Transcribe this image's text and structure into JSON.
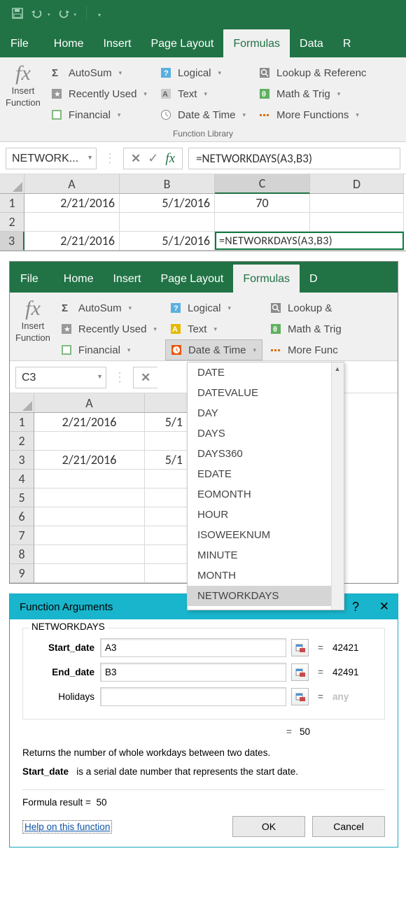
{
  "tabs": {
    "file": "File",
    "home": "Home",
    "insert": "Insert",
    "layout": "Page Layout",
    "formulas": "Formulas",
    "data": "Data",
    "r": "R"
  },
  "ribbon": {
    "insert_fn": {
      "l1": "Insert",
      "l2": "Function"
    },
    "autosum": "AutoSum",
    "recent": "Recently Used",
    "financial": "Financial",
    "logical": "Logical",
    "text": "Text",
    "datetime": "Date & Time",
    "lookup": "Lookup & Referenc",
    "lookup2": "Lookup & ",
    "math": "Math & Trig",
    "math2": "Math & Trig",
    "more": "More Functions",
    "more2": "More Func",
    "library": "Function Library"
  },
  "p1": {
    "namebox": "NETWORK...",
    "fbar": "=NETWORKDAYS(A3,B3)",
    "cols": [
      "A",
      "B",
      "C",
      "D"
    ],
    "row1": {
      "a": "2/21/2016",
      "b": "5/1/2016",
      "c": "70"
    },
    "row3": {
      "a": "2/21/2016",
      "b": "5/1/2016",
      "c": "=NETWORKDAYS(A3,B3)"
    }
  },
  "p2": {
    "namebox": "C3",
    "cols": [
      "A"
    ],
    "row1": {
      "a": "2/21/2016",
      "b": "5/1"
    },
    "row3": {
      "a": "2/21/2016",
      "b": "5/1"
    },
    "dropdown": [
      "DATE",
      "DATEVALUE",
      "DAY",
      "DAYS",
      "DAYS360",
      "EDATE",
      "EOMONTH",
      "HOUR",
      "ISOWEEKNUM",
      "MINUTE",
      "MONTH",
      "NETWORKDAYS"
    ]
  },
  "dialog": {
    "title": "Function Arguments",
    "fn": "NETWORKDAYS",
    "args": [
      {
        "label": "Start_date",
        "value": "A3",
        "result": "42421",
        "bold": true
      },
      {
        "label": "End_date",
        "value": "B3",
        "result": "42491",
        "bold": true
      },
      {
        "label": "Holidays",
        "value": "",
        "result": "any",
        "bold": false
      }
    ],
    "total": "50",
    "desc": "Returns the number of whole workdays between two dates.",
    "argname": "Start_date",
    "argdesc": "is a serial date number that represents the start date.",
    "result_label": "Formula result =",
    "result": "50",
    "help": "Help on this function",
    "ok": "OK",
    "cancel": "Cancel"
  }
}
